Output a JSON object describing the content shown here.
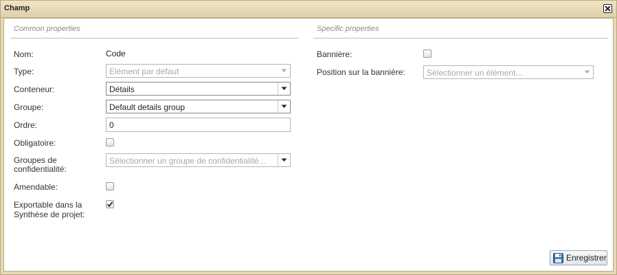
{
  "window": {
    "title": "Champ"
  },
  "sections": {
    "common": "Common properties",
    "specific": "Specific properties"
  },
  "common": {
    "nom": {
      "label": "Nom:",
      "value": "Code"
    },
    "type": {
      "label": "Type:",
      "value": "Elément par défaut"
    },
    "conteneur": {
      "label": "Conteneur:",
      "value": "Détails"
    },
    "groupe": {
      "label": "Groupe:",
      "value": "Default details group"
    },
    "ordre": {
      "label": "Ordre:",
      "value": "0"
    },
    "obligatoire": {
      "label": "Obligatoire:",
      "checked": false
    },
    "confidentialite": {
      "label_line1": "Groupes de",
      "label_line2": "confidentialité:",
      "placeholder": "Sélectionner un groupe de confidentialité..."
    },
    "amendable": {
      "label": "Amendable:",
      "checked": false
    },
    "exportable": {
      "label_line1": "Exportable dans la",
      "label_line2": "Synthèse de projet:",
      "checked": true
    }
  },
  "specific": {
    "banniere": {
      "label": "Bannière:",
      "checked": false
    },
    "position": {
      "label": "Position sur la bannière:",
      "placeholder": "Sélectionner un élément..."
    }
  },
  "footer": {
    "save_label": "Enregistrer"
  },
  "colors": {
    "titlebar": "#e6d9b6",
    "border": "#b8a880",
    "save_icon": "#3a6ea8"
  }
}
